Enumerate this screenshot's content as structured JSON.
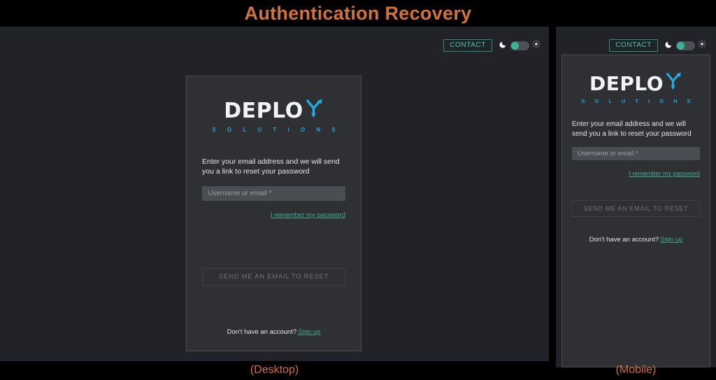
{
  "page": {
    "title": "Authentication Recovery",
    "title_color": "#d4713a",
    "background_color": "#000000"
  },
  "theme": {
    "accent_teal": "#3fae95",
    "logo_cyan": "#22a9e0",
    "card_background": "#2e3034",
    "page_background": "#212328",
    "input_background": "#4a4d52"
  },
  "header": {
    "contact_label": "CONTACT",
    "moon_icon": "moon-icon",
    "sun_icon": "sun-icon",
    "theme_toggle_state": "dark"
  },
  "logo": {
    "wordmark": "DEPLO",
    "mark_letter": "Y",
    "tagline": "S O L U T I O N S"
  },
  "form": {
    "instruction": "Enter your email address and we will send you a link to reset your password",
    "email_placeholder": "Username or email *",
    "email_value": "",
    "remember_link": "I remember my password",
    "submit_label": "SEND ME AN EMAIL TO RESET",
    "signup_prompt": "Don't have an account?",
    "signup_link": "Sign up"
  },
  "captions": {
    "desktop": "(Desktop)",
    "mobile": "(Mobile)"
  }
}
